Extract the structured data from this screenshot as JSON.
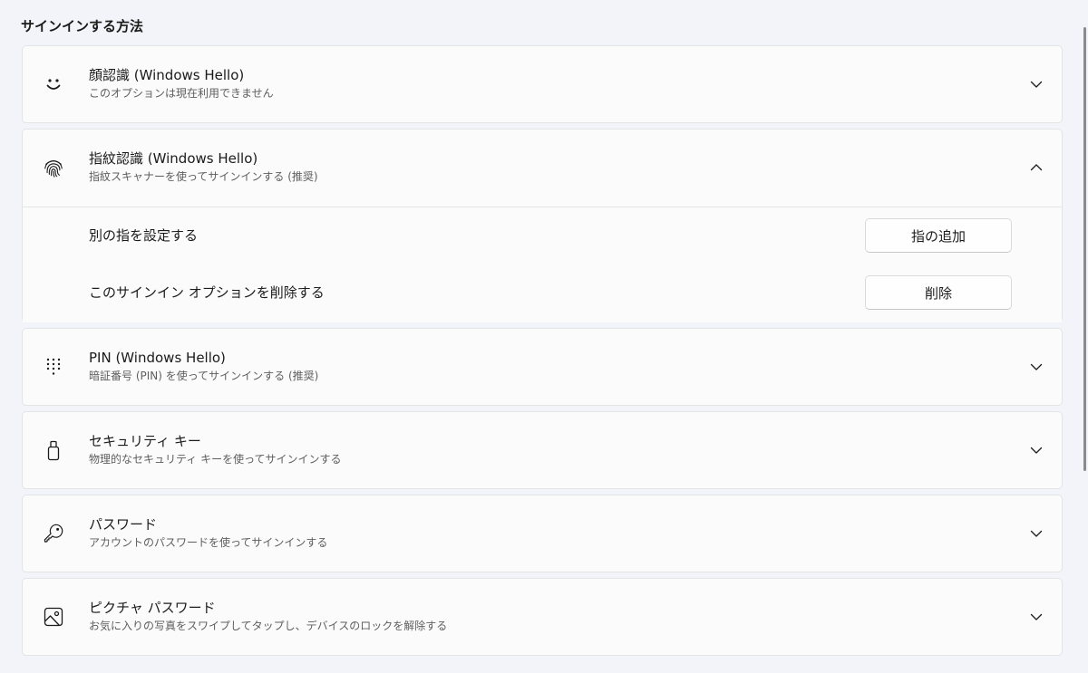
{
  "section": {
    "title": "サインインする方法"
  },
  "options": [
    {
      "title": "顔認識 (Windows Hello)",
      "subtitle": "このオプションは現在利用できません",
      "icon": "face-icon",
      "expanded": false
    },
    {
      "title": "指紋認識 (Windows Hello)",
      "subtitle": "指紋スキャナーを使ってサインインする (推奨)",
      "icon": "fingerprint-icon",
      "expanded": true,
      "settings": [
        {
          "label": "別の指を設定する",
          "button": "指の追加"
        },
        {
          "label": "このサインイン オプションを削除する",
          "button": "削除"
        }
      ]
    },
    {
      "title": "PIN (Windows Hello)",
      "subtitle": "暗証番号 (PIN) を使ってサインインする (推奨)",
      "icon": "keypad-icon",
      "expanded": false
    },
    {
      "title": "セキュリティ キー",
      "subtitle": "物理的なセキュリティ キーを使ってサインインする",
      "icon": "usb-key-icon",
      "expanded": false
    },
    {
      "title": "パスワード",
      "subtitle": "アカウントのパスワードを使ってサインインする",
      "icon": "key-icon",
      "expanded": false
    },
    {
      "title": "ピクチャ パスワード",
      "subtitle": "お気に入りの写真をスワイプしてタップし、デバイスのロックを解除する",
      "icon": "picture-icon",
      "expanded": false
    }
  ],
  "colors": {
    "background": "#f3f4f9",
    "card": "#fbfbfc",
    "border": "#e3e4e8",
    "text": "#1b1b1b",
    "subtext": "#5e5e5e"
  }
}
